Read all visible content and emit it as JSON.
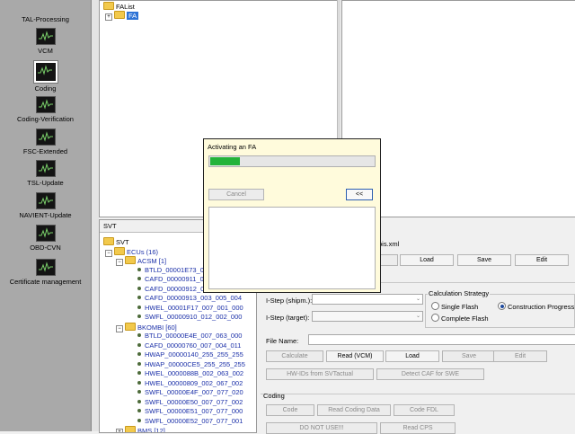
{
  "sidebar": {
    "items": [
      {
        "label": "TAL-Processing",
        "icon": "monitor-icon",
        "selected": false
      },
      {
        "label": "VCM",
        "icon": "monitor-icon",
        "selected": false
      },
      {
        "label": "Coding",
        "icon": "monitor-icon",
        "selected": true
      },
      {
        "label": "Coding-Verification",
        "icon": "monitor-icon",
        "selected": false
      },
      {
        "label": "FSC-Extended",
        "icon": "monitor-icon",
        "selected": false
      },
      {
        "label": "TSL-Update",
        "icon": "monitor-icon",
        "selected": false
      },
      {
        "label": "NAVIENT-Update",
        "icon": "monitor-icon",
        "selected": false
      },
      {
        "label": "OBD-CVN",
        "icon": "monitor-icon",
        "selected": false
      },
      {
        "label": "Certificate management",
        "icon": "monitor-icon",
        "selected": false
      }
    ]
  },
  "fa_tree": {
    "root": "FAList",
    "child": "FA"
  },
  "svt": {
    "title": "SVT",
    "root": "SVT",
    "ecus": "ECUs (16)",
    "groups": [
      {
        "name": "ACSM [1]",
        "items": [
          "BTLD_00001E73_00",
          "CAFD_00000911_0",
          "CAFD_00000912_0",
          "CAFD_00000913_003_005_004",
          "HWEL_00001F17_007_001_000",
          "SWFL_00000910_012_002_000"
        ]
      },
      {
        "name": "BKOMBI [60]",
        "items": [
          "BTLD_00000E4E_007_063_000",
          "CAFD_00000760_007_004_011",
          "HWAP_00000140_255_255_255",
          "HWAP_00000CE5_255_255_255",
          "HWEL_0000088B_002_063_002",
          "HWEL_00000809_002_067_002",
          "SWFL_00000E4F_007_077_020",
          "SWFL_00000E50_007_077_002",
          "SWFL_00000E51_007_077_000",
          "SWFL_00000E52_007_077_001"
        ]
      }
    ],
    "partial_group": "BMS [12]"
  },
  "right_panel": {
    "file_fragment": "pis.xml",
    "top_buttons": [
      "Load",
      "Save",
      "Edit"
    ],
    "istep_shipm_label": "I-Step (shipm.):",
    "istep_target_label": "I-Step (target):",
    "calc_strategy": {
      "title": "Calculation Strategy",
      "single": "Single Flash",
      "construction": "Construction Progress",
      "complete": "Complete Flash",
      "selected": "construction"
    },
    "file_name_label": "File Name:",
    "file_buttons": [
      "Calculate",
      "Read (VCM)",
      "Load",
      "Save",
      "Edit"
    ],
    "hw_buttons": [
      "HW-IDs from SVTactual",
      "Detect CAF for SWE"
    ],
    "coding": {
      "title": "Coding",
      "row1": [
        "Code",
        "Read Coding Data",
        "Code FDL"
      ],
      "row2": [
        "DO NOT USE!!!",
        "Read CPS"
      ]
    }
  },
  "dialog": {
    "title": "Activating an FA",
    "progress": 0.18,
    "cancel_label": "Cancel",
    "toggle_label": "<<"
  },
  "colors": {
    "sidebar": "#a9a9a9",
    "progress": "#23b33a",
    "dialog_bg": "#fffbdc",
    "link_blue": "#1a2fa8"
  }
}
